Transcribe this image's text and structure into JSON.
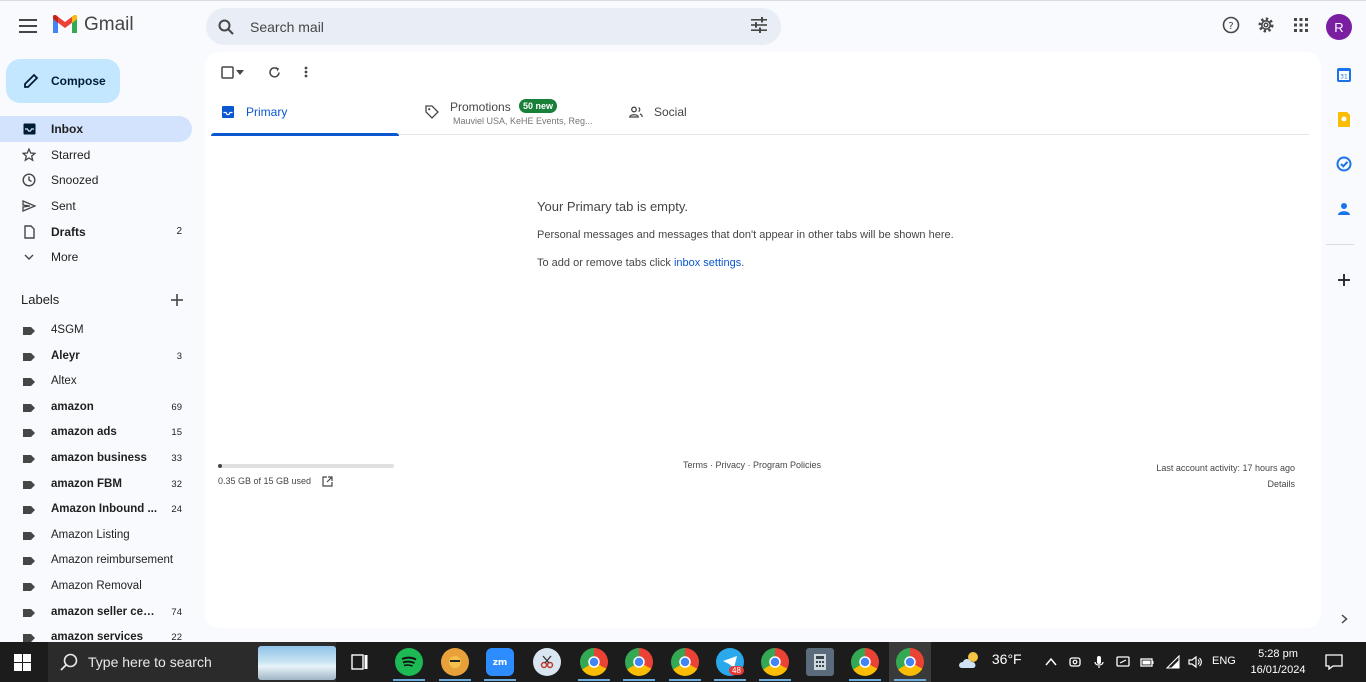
{
  "app": {
    "name": "Gmail"
  },
  "search": {
    "placeholder": "Search mail"
  },
  "header": {
    "avatar_letter": "R"
  },
  "compose": {
    "label": "Compose"
  },
  "nav": [
    {
      "label": "Inbox",
      "count": "",
      "active": true,
      "bold": true,
      "icon": "inbox-icon"
    },
    {
      "label": "Starred",
      "count": "",
      "icon": "star-icon"
    },
    {
      "label": "Snoozed",
      "count": "",
      "icon": "clock-icon"
    },
    {
      "label": "Sent",
      "count": "",
      "icon": "send-icon"
    },
    {
      "label": "Drafts",
      "count": "2",
      "bold": true,
      "icon": "draft-icon"
    },
    {
      "label": "More",
      "count": "",
      "icon": "chevron-down-icon"
    }
  ],
  "labels_header": "Labels",
  "labels": [
    {
      "label": "4SGM",
      "count": "",
      "bold": false
    },
    {
      "label": "Aleyr",
      "count": "3",
      "bold": true
    },
    {
      "label": "Altex",
      "count": "",
      "bold": false
    },
    {
      "label": "amazon",
      "count": "69",
      "bold": true
    },
    {
      "label": "amazon ads",
      "count": "15",
      "bold": true
    },
    {
      "label": "amazon business",
      "count": "33",
      "bold": true
    },
    {
      "label": "amazon FBM",
      "count": "32",
      "bold": true
    },
    {
      "label": "Amazon Inbound ...",
      "count": "24",
      "bold": true
    },
    {
      "label": "Amazon Listing",
      "count": "",
      "bold": false
    },
    {
      "label": "Amazon reimbursement",
      "count": "",
      "bold": false
    },
    {
      "label": "Amazon Removal",
      "count": "",
      "bold": false
    },
    {
      "label": "amazon seller cen...",
      "count": "74",
      "bold": true
    },
    {
      "label": "amazon services",
      "count": "22",
      "bold": true
    }
  ],
  "tabs": {
    "primary": "Primary",
    "promotions": "Promotions",
    "promotions_badge": "50 new",
    "promotions_snippet": "Mauviel USA, KeHE Events, Reg...",
    "social": "Social"
  },
  "empty": {
    "title": "Your Primary tab is empty.",
    "desc": "Personal messages and messages that don't appear in other tabs will be shown here.",
    "hint_prefix": "To add or remove tabs click ",
    "hint_link": "inbox settings",
    "hint_suffix": "."
  },
  "storage": {
    "text": "0.35 GB of 15 GB used",
    "fraction": 0.023
  },
  "footer": {
    "terms": "Terms",
    "privacy": "Privacy",
    "policies": "Program Policies",
    "sep": " · "
  },
  "activity": {
    "line1": "Last account activity: 17 hours ago",
    "line2": "Details"
  },
  "taskbar": {
    "search_text": "Type here to search",
    "weather": "36°F",
    "lang": "ENG",
    "time": "5:28 pm",
    "date": "16/01/2024",
    "telegram_badge": "48"
  },
  "colors": {
    "accent": "#0b57d0",
    "compose_bg": "#c2e7ff",
    "active_bg": "#d3e3fd",
    "badge_green": "#188038"
  }
}
